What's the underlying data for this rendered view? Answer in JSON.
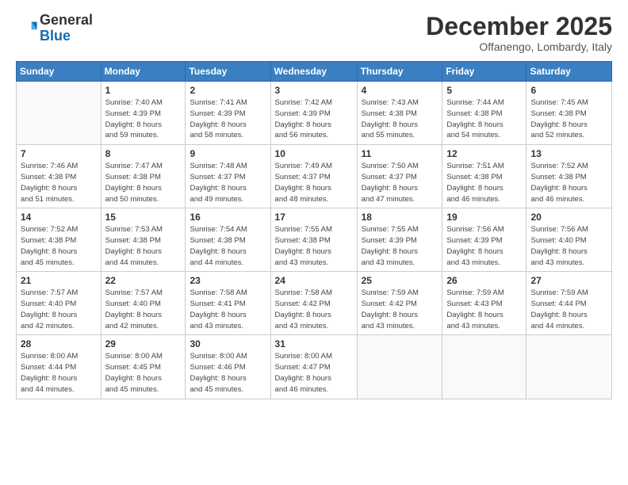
{
  "logo": {
    "general": "General",
    "blue": "Blue"
  },
  "title": "December 2025",
  "location": "Offanengo, Lombardy, Italy",
  "headers": [
    "Sunday",
    "Monday",
    "Tuesday",
    "Wednesday",
    "Thursday",
    "Friday",
    "Saturday"
  ],
  "weeks": [
    [
      {
        "day": "",
        "info": ""
      },
      {
        "day": "1",
        "info": "Sunrise: 7:40 AM\nSunset: 4:39 PM\nDaylight: 8 hours\nand 59 minutes."
      },
      {
        "day": "2",
        "info": "Sunrise: 7:41 AM\nSunset: 4:39 PM\nDaylight: 8 hours\nand 58 minutes."
      },
      {
        "day": "3",
        "info": "Sunrise: 7:42 AM\nSunset: 4:39 PM\nDaylight: 8 hours\nand 56 minutes."
      },
      {
        "day": "4",
        "info": "Sunrise: 7:43 AM\nSunset: 4:38 PM\nDaylight: 8 hours\nand 55 minutes."
      },
      {
        "day": "5",
        "info": "Sunrise: 7:44 AM\nSunset: 4:38 PM\nDaylight: 8 hours\nand 54 minutes."
      },
      {
        "day": "6",
        "info": "Sunrise: 7:45 AM\nSunset: 4:38 PM\nDaylight: 8 hours\nand 52 minutes."
      }
    ],
    [
      {
        "day": "7",
        "info": "Sunrise: 7:46 AM\nSunset: 4:38 PM\nDaylight: 8 hours\nand 51 minutes."
      },
      {
        "day": "8",
        "info": "Sunrise: 7:47 AM\nSunset: 4:38 PM\nDaylight: 8 hours\nand 50 minutes."
      },
      {
        "day": "9",
        "info": "Sunrise: 7:48 AM\nSunset: 4:37 PM\nDaylight: 8 hours\nand 49 minutes."
      },
      {
        "day": "10",
        "info": "Sunrise: 7:49 AM\nSunset: 4:37 PM\nDaylight: 8 hours\nand 48 minutes."
      },
      {
        "day": "11",
        "info": "Sunrise: 7:50 AM\nSunset: 4:37 PM\nDaylight: 8 hours\nand 47 minutes."
      },
      {
        "day": "12",
        "info": "Sunrise: 7:51 AM\nSunset: 4:38 PM\nDaylight: 8 hours\nand 46 minutes."
      },
      {
        "day": "13",
        "info": "Sunrise: 7:52 AM\nSunset: 4:38 PM\nDaylight: 8 hours\nand 46 minutes."
      }
    ],
    [
      {
        "day": "14",
        "info": "Sunrise: 7:52 AM\nSunset: 4:38 PM\nDaylight: 8 hours\nand 45 minutes."
      },
      {
        "day": "15",
        "info": "Sunrise: 7:53 AM\nSunset: 4:38 PM\nDaylight: 8 hours\nand 44 minutes."
      },
      {
        "day": "16",
        "info": "Sunrise: 7:54 AM\nSunset: 4:38 PM\nDaylight: 8 hours\nand 44 minutes."
      },
      {
        "day": "17",
        "info": "Sunrise: 7:55 AM\nSunset: 4:38 PM\nDaylight: 8 hours\nand 43 minutes."
      },
      {
        "day": "18",
        "info": "Sunrise: 7:55 AM\nSunset: 4:39 PM\nDaylight: 8 hours\nand 43 minutes."
      },
      {
        "day": "19",
        "info": "Sunrise: 7:56 AM\nSunset: 4:39 PM\nDaylight: 8 hours\nand 43 minutes."
      },
      {
        "day": "20",
        "info": "Sunrise: 7:56 AM\nSunset: 4:40 PM\nDaylight: 8 hours\nand 43 minutes."
      }
    ],
    [
      {
        "day": "21",
        "info": "Sunrise: 7:57 AM\nSunset: 4:40 PM\nDaylight: 8 hours\nand 42 minutes."
      },
      {
        "day": "22",
        "info": "Sunrise: 7:57 AM\nSunset: 4:40 PM\nDaylight: 8 hours\nand 42 minutes."
      },
      {
        "day": "23",
        "info": "Sunrise: 7:58 AM\nSunset: 4:41 PM\nDaylight: 8 hours\nand 43 minutes."
      },
      {
        "day": "24",
        "info": "Sunrise: 7:58 AM\nSunset: 4:42 PM\nDaylight: 8 hours\nand 43 minutes."
      },
      {
        "day": "25",
        "info": "Sunrise: 7:59 AM\nSunset: 4:42 PM\nDaylight: 8 hours\nand 43 minutes."
      },
      {
        "day": "26",
        "info": "Sunrise: 7:59 AM\nSunset: 4:43 PM\nDaylight: 8 hours\nand 43 minutes."
      },
      {
        "day": "27",
        "info": "Sunrise: 7:59 AM\nSunset: 4:44 PM\nDaylight: 8 hours\nand 44 minutes."
      }
    ],
    [
      {
        "day": "28",
        "info": "Sunrise: 8:00 AM\nSunset: 4:44 PM\nDaylight: 8 hours\nand 44 minutes."
      },
      {
        "day": "29",
        "info": "Sunrise: 8:00 AM\nSunset: 4:45 PM\nDaylight: 8 hours\nand 45 minutes."
      },
      {
        "day": "30",
        "info": "Sunrise: 8:00 AM\nSunset: 4:46 PM\nDaylight: 8 hours\nand 45 minutes."
      },
      {
        "day": "31",
        "info": "Sunrise: 8:00 AM\nSunset: 4:47 PM\nDaylight: 8 hours\nand 46 minutes."
      },
      {
        "day": "",
        "info": ""
      },
      {
        "day": "",
        "info": ""
      },
      {
        "day": "",
        "info": ""
      }
    ]
  ]
}
